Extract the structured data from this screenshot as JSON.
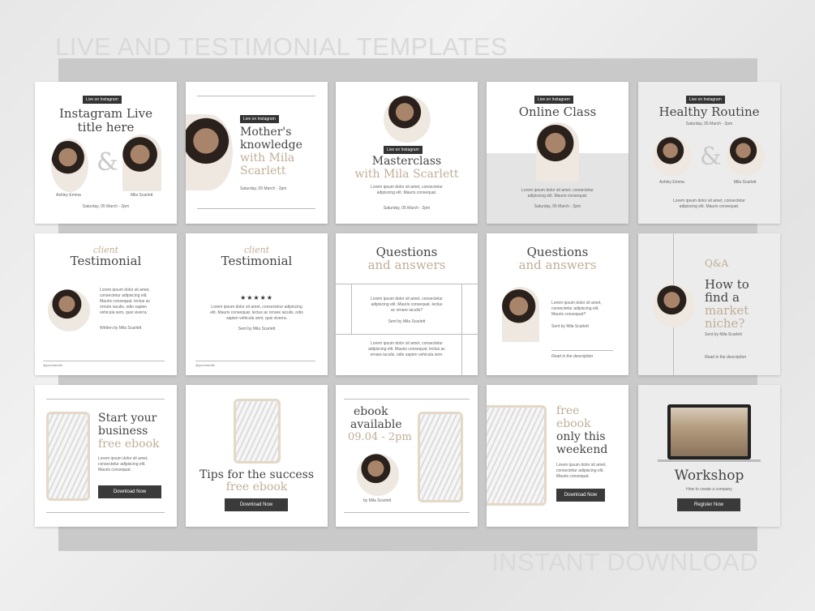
{
  "header": {
    "title": "LIVE AND TESTIMONIAL TEMPLATES"
  },
  "footer": {
    "title": "INSTANT DOWNLOAD"
  },
  "cards": {
    "c1": {
      "badge": "Live on Instagram",
      "title1": "Instagram Live",
      "title2": "title here",
      "amp": "&",
      "name_left": "Ashley Emma",
      "name_right": "Mila Scarlett",
      "date": "Saturday, 05 March - 2pm"
    },
    "c2": {
      "badge": "Live on Instagram",
      "title1": "Mother's",
      "title2": "knowledge",
      "title3": "with Mila",
      "title4": "Scarlett",
      "date": "Saturday, 05 March - 2pm"
    },
    "c3": {
      "badge": "Live on Instagram",
      "title1": "Masterclass",
      "title2": "with Mila Scarlett",
      "body1": "Lorem ipsum dolor sit amet, consectetur",
      "body2": "adipiscing elit. Mauris consequat.",
      "date": "Saturday, 05 March - 2pm"
    },
    "c4": {
      "badge": "Live on Instagram",
      "title1": "Online Class",
      "body1": "Lorem ipsum dolor sit amet, consectetur",
      "body2": "adipiscing elit. Mauris consequat.",
      "date": "Saturday, 05 March - 2pm"
    },
    "c5": {
      "badge": "Live on Instagram",
      "title1": "Healthy Routine",
      "date": "Saturday, 05 March - 2pm",
      "amp": "&",
      "name_left": "Ashley Emma",
      "name_right": "Mila Scarlett",
      "body1": "Lorem ipsum dolor sit amet, consectetur",
      "body2": "adipiscing elit. Mauris consequat."
    },
    "c6": {
      "script": "client",
      "title": "Testimonial",
      "body1": "Lorem ipsum dolor sit amet,",
      "body2": "consectetur adipiscing elit.",
      "body3": "Mauris consequat. lectus ac",
      "body4": "ornare iaculis, odio sapien",
      "body5": "vehicula sem, quis viverra.",
      "author": "Written by Mila Scarlett",
      "handle": "@yourhandle"
    },
    "c7": {
      "script": "client",
      "title": "Testimonial",
      "stars": "★★★★★",
      "body1": "Lorem ipsum dolor sit amet, consectetur adipiscing",
      "body2": "elit. Mauris consequat. lectus ac ornare iaculis, odio",
      "body3": "sapien vehicula sem, quis viverra.",
      "author": "Sent by Mila Scarlett",
      "handle": "@yourhandle"
    },
    "c8": {
      "title1": "Questions",
      "title2": "and answers",
      "body1": "Lorem ipsum dolor sit amet, consectetur",
      "body2": "adipiscing elit. Mauris consequat. lectus",
      "body3": "ac ornare iaculis?",
      "author": "Sent by Mila Scarlett",
      "body4": "Lorem ipsum dolor sit amet, consectetur",
      "body5": "adipiscing elit. Mauris consequat. lectus ac",
      "body6": "ornare iaculis, odio sapien vehicula sem."
    },
    "c9": {
      "title1": "Questions",
      "title2": "and answers",
      "body1": "Lorem ipsum dolor sit amet,",
      "body2": "consectetur adipiscing elit.",
      "body3": "Mauris consequat?",
      "author": "Sent by Mila Scarlett",
      "footer": "Read in the description"
    },
    "c10": {
      "label": "Q&A",
      "title1": "How to",
      "title2": "find a",
      "title3": "market",
      "title4": "niche?",
      "author": "Sent by Mila Scarlett",
      "footer": "Read in the description"
    },
    "c11": {
      "title1": "Start your",
      "title2": "business",
      "title3": "free ebook",
      "body1": "Lorem ipsum dolor sit amet,",
      "body2": "consectetur adipiscing elit.",
      "body3": "Mauris consequat.",
      "button": "Download Now"
    },
    "c12": {
      "title1": "Tips for the success",
      "title2": "free ebook",
      "button": "Download Now"
    },
    "c13": {
      "title1": "ebook",
      "title2": "available",
      "title3": "09.04 - 2pm",
      "author": "by Mila Scarlett"
    },
    "c14": {
      "title1": "free",
      "title2": "ebook",
      "title3": "only this",
      "title4": "weekend",
      "body1": "Lorem ipsum dolor sit amet,",
      "body2": "consectetur adipiscing elit.",
      "body3": "Mauris consequat.",
      "button": "Download Now"
    },
    "c15": {
      "title": "Workshop",
      "subtitle": "How to create a company",
      "button": "Register Now"
    }
  },
  "colors": {
    "accent": "#bfae96",
    "dark": "#3a3a3a",
    "backdrop": "#c9c9c9"
  }
}
